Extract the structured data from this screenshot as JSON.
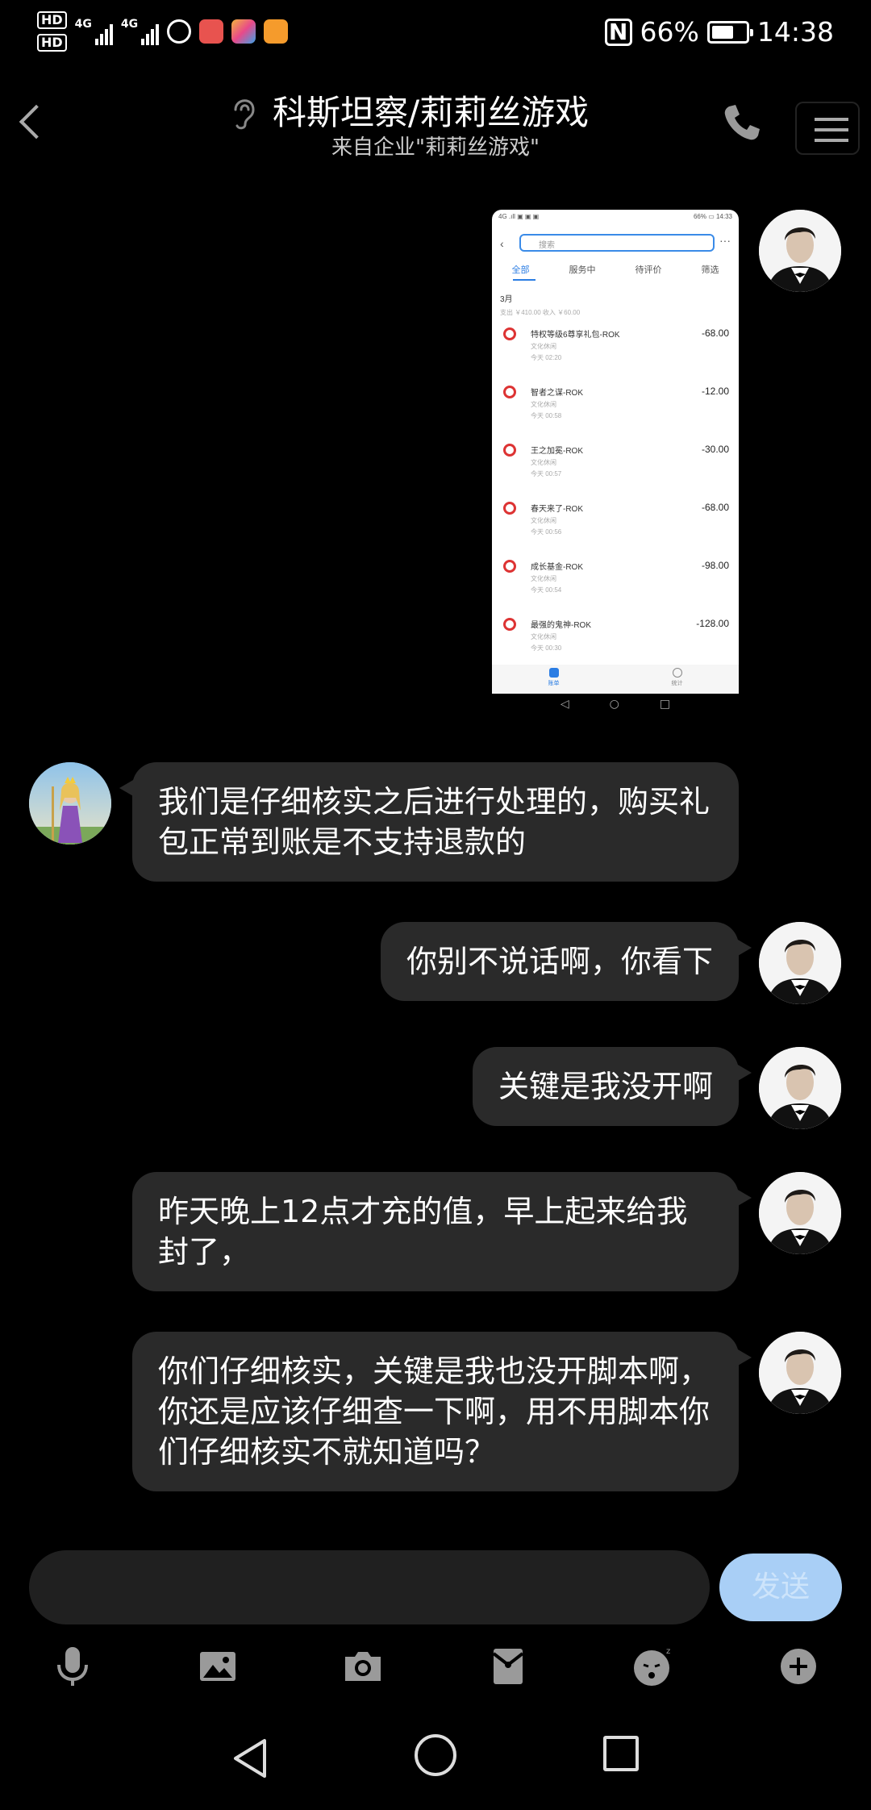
{
  "status_bar": {
    "hd1": "HD",
    "hd2": "HD",
    "net1": "4G",
    "net2": "4G",
    "battery": "66%",
    "time": "14:38",
    "nfc_icon": "N",
    "icons": [
      "hd-icon",
      "signal-icon",
      "signal-icon",
      "app-icon",
      "app-icon",
      "app-icon",
      "app-icon",
      "nfc-icon",
      "battery-icon"
    ]
  },
  "header": {
    "title": "科斯坦察/莉莉丝游戏",
    "subtitle": "来自企业\"莉莉丝游戏\""
  },
  "screenshot": {
    "status_left": "4G .ıll ▣ ▣ ▣",
    "status_right": "66% ▭ 14:33",
    "search_placeholder": "搜索",
    "more": "···",
    "tabs": [
      "全部",
      "服务中",
      "待评价",
      "筛选"
    ],
    "month": "3月",
    "summary": "支出 ￥410.00  收入 ￥60.00",
    "rows": [
      {
        "name": "特权等级6尊享礼包-ROK",
        "category": "文化休闲",
        "time": "今天 02:20",
        "amount": "-68.00"
      },
      {
        "name": "智者之谋-ROK",
        "category": "文化休闲",
        "time": "今天 00:58",
        "amount": "-12.00"
      },
      {
        "name": "王之加冕-ROK",
        "category": "文化休闲",
        "time": "今天 00:57",
        "amount": "-30.00"
      },
      {
        "name": "春天来了-ROK",
        "category": "文化休闲",
        "time": "今天 00:56",
        "amount": "-68.00"
      },
      {
        "name": "成长基金-ROK",
        "category": "文化休闲",
        "time": "今天 00:54",
        "amount": "-98.00"
      },
      {
        "name": "最强的鬼神-ROK",
        "category": "文化休闲",
        "time": "今天 00:30",
        "amount": "-128.00"
      }
    ],
    "tabbar": [
      "账单",
      "统计"
    ]
  },
  "messages": {
    "m1": "我们是仔细核实之后进行处理的，购买礼包正常到账是不支持退款的",
    "m2": "你别不说话啊，你看下",
    "m3": "关键是我没开啊",
    "m4": "昨天晚上12点才充的值，早上起来给我封了，",
    "m5": "你们仔细核实，关键是我也没开脚本啊，你还是应该仔细查一下啊，用不用脚本你们仔细核实不就知道吗？"
  },
  "composer": {
    "input_value": "",
    "send_label": "发送"
  },
  "toolbar_icons": [
    "microphone-icon",
    "image-icon",
    "camera-icon",
    "red-packet-icon",
    "emoji-icon",
    "plus-icon"
  ],
  "colors": {
    "background": "#000000",
    "bubble": "#2a2a2a",
    "send_button": "#a9cff6",
    "accent_blue": "#2b7de3"
  }
}
